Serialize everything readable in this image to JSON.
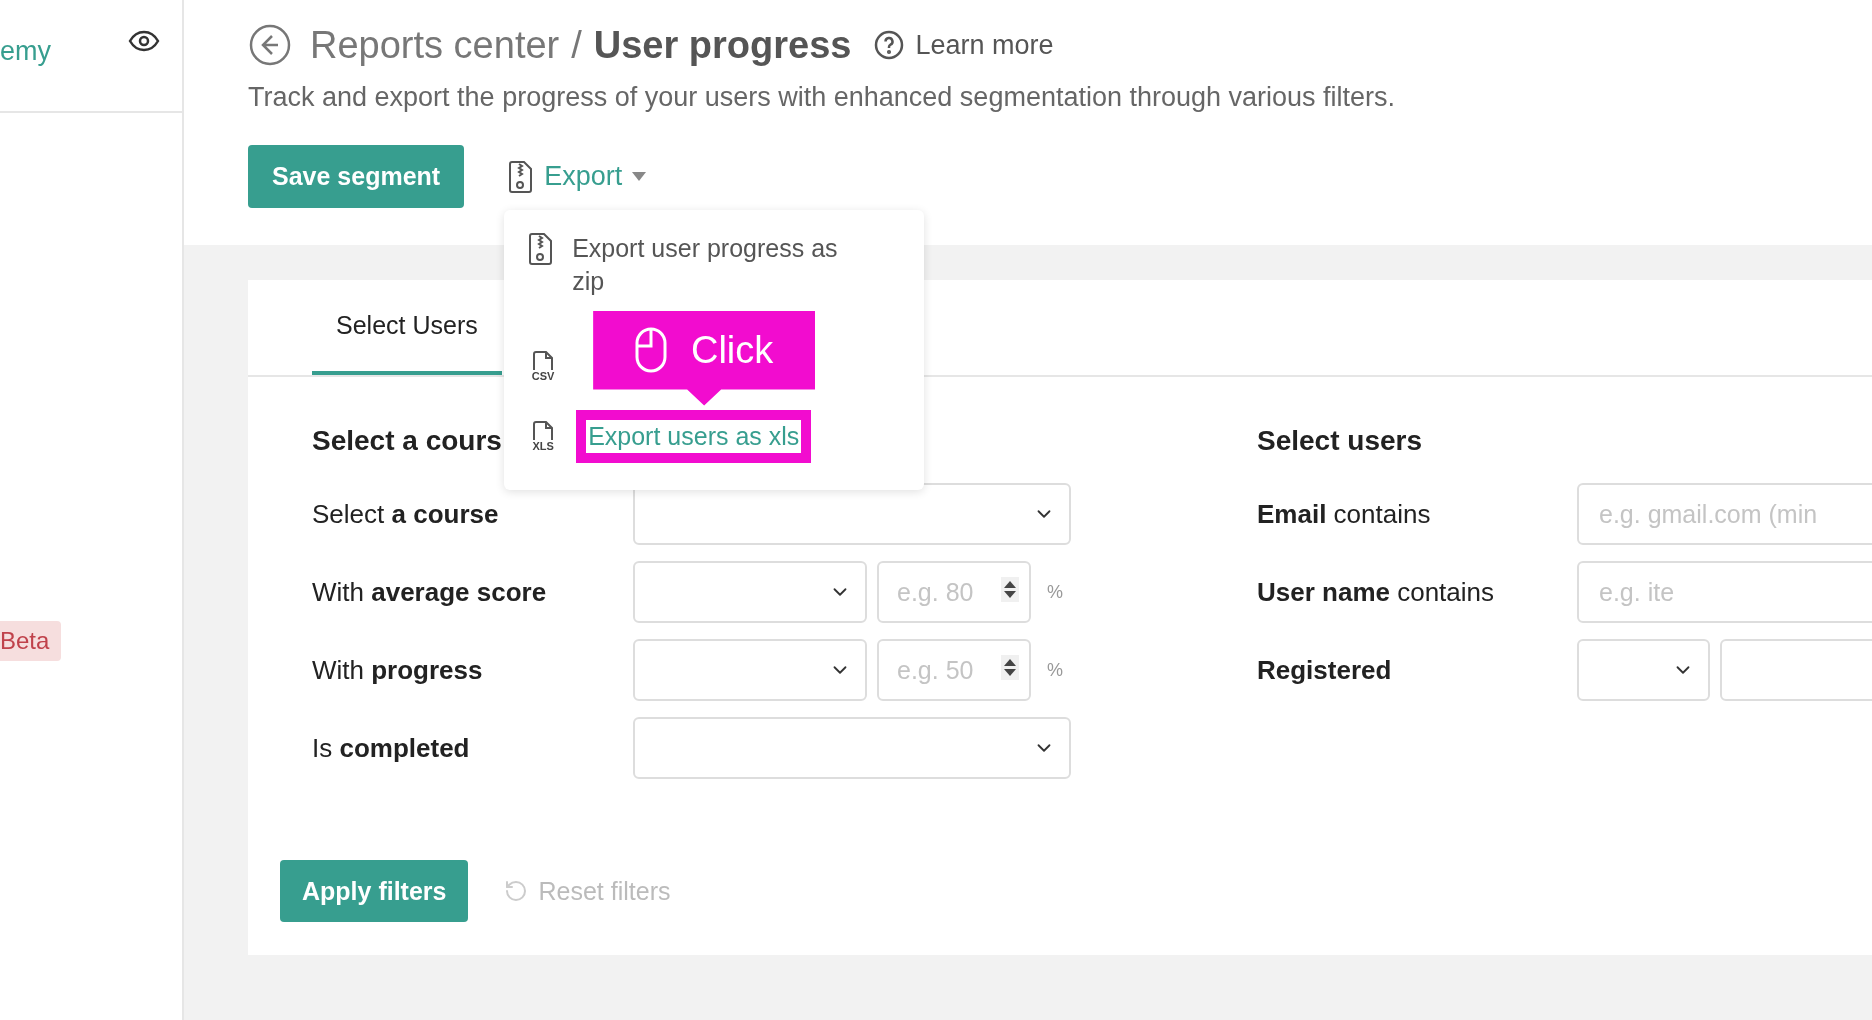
{
  "sidebar": {
    "brand": "emy",
    "badge": "Beta"
  },
  "header": {
    "breadcrumb_parent": "Reports center",
    "separator": "/",
    "title": "User progress",
    "learn_more": "Learn more",
    "subtitle": "Track and export the progress of your users with enhanced segmentation through various filters.",
    "save_button": "Save segment",
    "export_button": "Export"
  },
  "export_menu": {
    "items": [
      {
        "kind": "zip",
        "label": "Export user progress as zip"
      },
      {
        "kind": "csv",
        "icon_text": "CSV"
      },
      {
        "kind": "xls",
        "icon_text": "XLS",
        "label": "Export users as xls",
        "highlighted": true
      }
    ]
  },
  "callout": {
    "label": "Click"
  },
  "tabs": [
    {
      "label": "Select Users",
      "selected": true
    }
  ],
  "course_section": {
    "heading": "Select a cours",
    "filters": [
      {
        "kind": "select",
        "label": "Select **a course**"
      },
      {
        "kind": "range",
        "label": "With **average score**",
        "placeholder": "e.g. 80",
        "unit": "%"
      },
      {
        "kind": "range",
        "label": "With **progress**",
        "placeholder": "e.g. 50",
        "unit": "%"
      },
      {
        "kind": "select",
        "label": "Is **completed**"
      }
    ]
  },
  "users_section": {
    "heading": "Select users",
    "filters": [
      {
        "kind": "text",
        "label": "**Email** contains",
        "placeholder": "e.g. gmail.com (min"
      },
      {
        "kind": "text",
        "label": "**User name** contains",
        "placeholder": "e.g. ite"
      },
      {
        "kind": "date",
        "label": "Registered"
      }
    ]
  },
  "footer": {
    "apply_button": "Apply filters",
    "reset_button": "Reset filters"
  }
}
